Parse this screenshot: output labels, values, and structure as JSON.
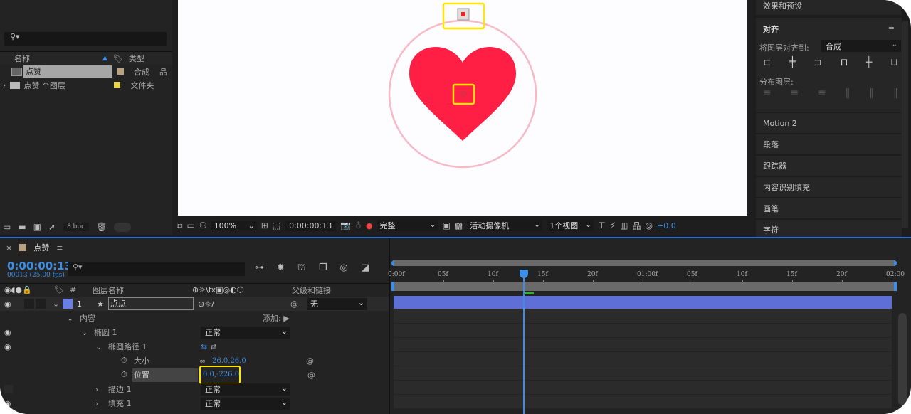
{
  "project": {
    "search_placeholder": "",
    "col_name": "名称",
    "col_type": "类型",
    "items": [
      {
        "name": "点赞",
        "type": "合成",
        "label_color": "#B9A27F"
      },
      {
        "name": "点赞 个图层",
        "type": "文件夹",
        "label_color": "#E8D44D"
      }
    ],
    "bpc": "8 bpc"
  },
  "viewer": {
    "zoom": "100%",
    "timecode": "0:00:00:13",
    "resolution": "完整",
    "camera": "活动摄像机",
    "views": "1个视图",
    "exposure": "+0.0"
  },
  "right": {
    "effects": "效果和预设",
    "align_title": "对齐",
    "align_to_label": "将图层对齐到:",
    "align_to_value": "合成",
    "distribute_label": "分布图层:",
    "sections": [
      "Motion 2",
      "段落",
      "跟踪器",
      "内容识别填充",
      "画笔",
      "字符"
    ]
  },
  "timeline": {
    "comp_tab": "点赞",
    "timecode": "0:00:00:13",
    "frames": "00013 (25.00 fps)",
    "col_num": "#",
    "col_layer_name": "图层名称",
    "col_parent": "父级和链接",
    "layer": {
      "index": "1",
      "name": "点点",
      "parent": "无",
      "color": "#6A7FE6"
    },
    "contents": "内容",
    "add": "添加:",
    "ellipse": "椭圆 1",
    "ellipse_mode": "正常",
    "ellipse_path": "椭圆路径 1",
    "size_label": "大小",
    "size_value": "26.0,26.0",
    "position_label": "位置",
    "position_value": "0.0,-226.0",
    "stroke": "描边 1",
    "stroke_mode": "正常",
    "fill": "填充 1",
    "fill_mode": "正常",
    "ruler": [
      "0:00f",
      "05f",
      "10f",
      "15f",
      "20f",
      "01:00f",
      "05f",
      "10f",
      "15f",
      "20f",
      "02:00"
    ]
  },
  "colors": {
    "accent": "#3D8EE6",
    "heart": "#FF1F45",
    "ring": "#F8B9C6",
    "highlight": "#FFE600",
    "layer_bar": "#5E6FD8"
  }
}
